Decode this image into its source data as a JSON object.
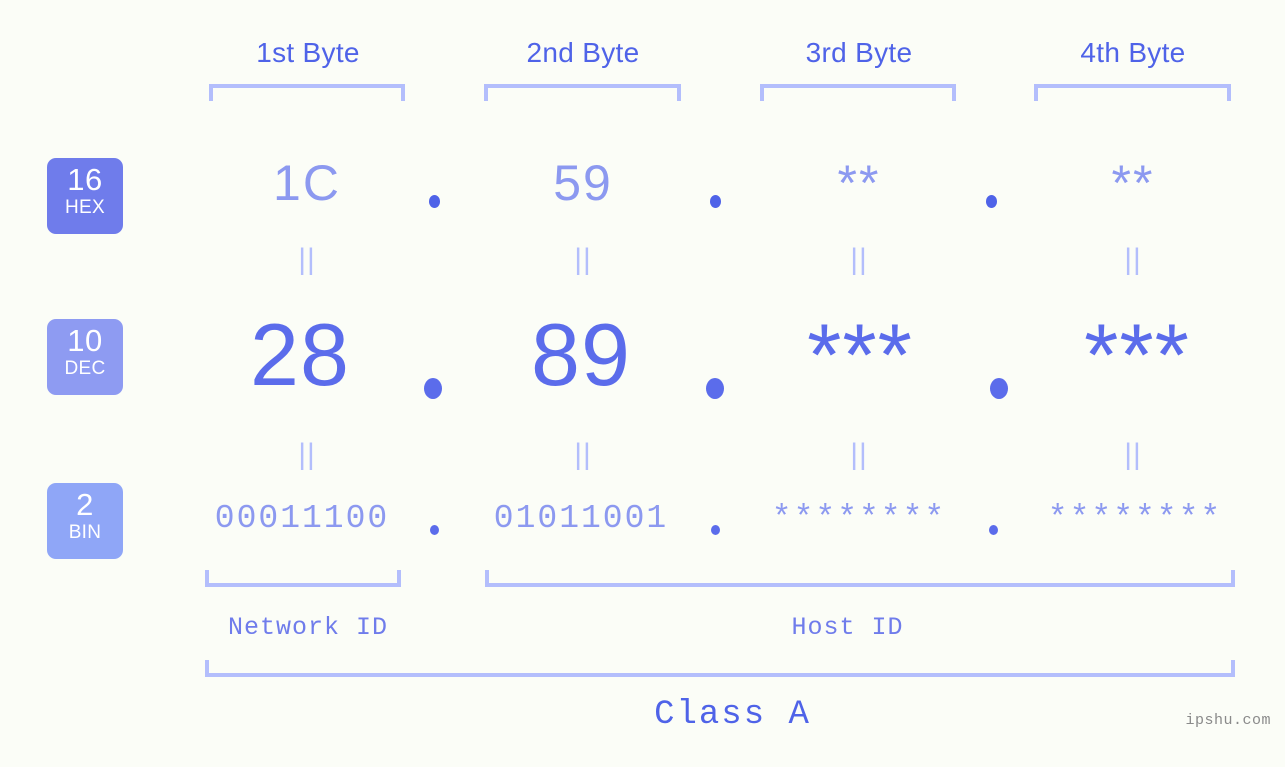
{
  "meta": {
    "watermark": "ipshu.com",
    "background": "#fbfdf7",
    "accent_dark": "#4f63e8",
    "accent_mid": "#5b6ceb",
    "accent_light": "#8c99f0",
    "bracket_color": "#b3befc"
  },
  "byte_headers": [
    {
      "label": "1st Byte"
    },
    {
      "label": "2nd Byte"
    },
    {
      "label": "3rd Byte"
    },
    {
      "label": "4th Byte"
    }
  ],
  "bases": [
    {
      "number": "16",
      "name": "HEX",
      "color": "#6f7ceb"
    },
    {
      "number": "10",
      "name": "DEC",
      "color": "#8e9bf2"
    },
    {
      "number": "2",
      "name": "BIN",
      "color": "#8fa6f7"
    }
  ],
  "rows": {
    "hex": {
      "base_number": "16",
      "base_name": "HEX",
      "values": [
        "1C",
        "59",
        "**",
        "**"
      ],
      "separator": "."
    },
    "dec": {
      "base_number": "10",
      "base_name": "DEC",
      "values": [
        "28",
        "89",
        "***",
        "***"
      ],
      "separator": "."
    },
    "bin": {
      "base_number": "2",
      "base_name": "BIN",
      "values": [
        "00011100",
        "01011001",
        "********",
        "********"
      ],
      "separator": "."
    }
  },
  "connectors": {
    "symbol": "||",
    "count_per_row": 4
  },
  "footer": {
    "network_id_label": "Network ID",
    "host_id_label": "Host ID",
    "class_label": "Class A"
  }
}
